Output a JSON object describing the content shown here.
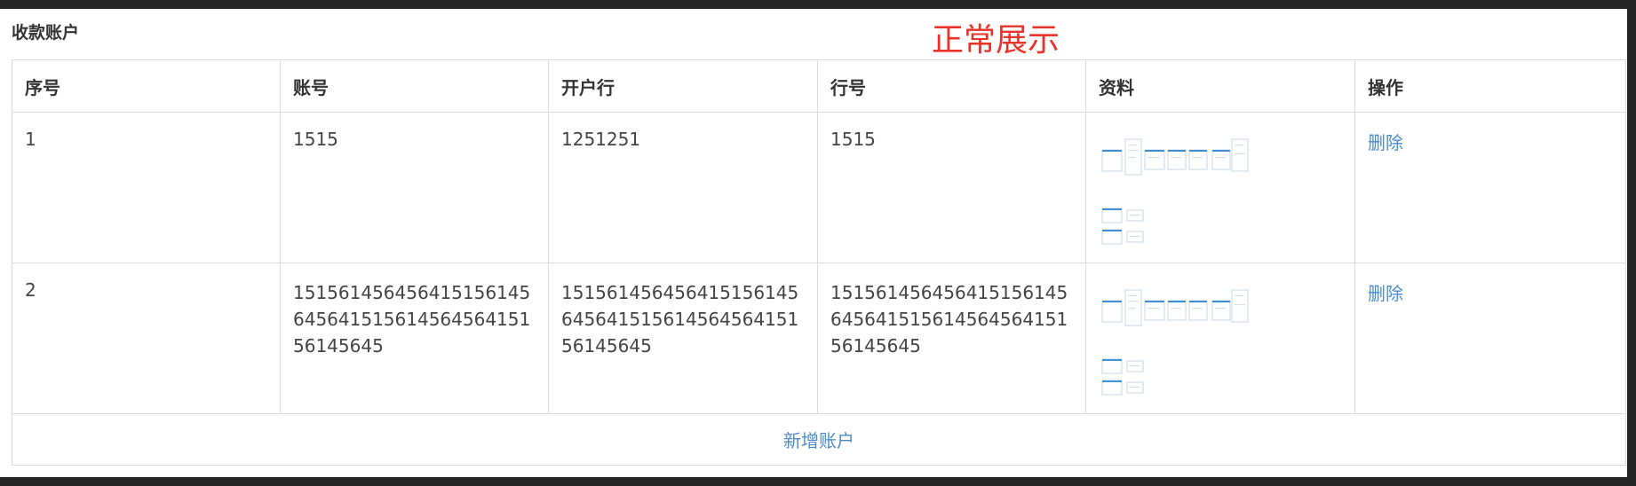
{
  "section_title": "收款账户",
  "annotation": "正常展示",
  "table": {
    "headers": [
      "序号",
      "账号",
      "开户行",
      "行号",
      "资料",
      "操作"
    ],
    "rows": [
      {
        "index": "1",
        "account": "1515",
        "bank": "1251251",
        "bank_code": "1515",
        "action": "删除"
      },
      {
        "index": "2",
        "account": "15156145645641515614564564151561456456415156145645",
        "bank": "15156145645641515614564564151561456456415156145645",
        "bank_code": "15156145645641515614564564151561456456415156145645",
        "action": "删除"
      }
    ],
    "add_label": "新增账户"
  },
  "colors": {
    "link": "#4a8cc9",
    "annotation": "#e8322a",
    "border": "#dcdcdc",
    "thumb_accent": "#3b8fd6"
  }
}
